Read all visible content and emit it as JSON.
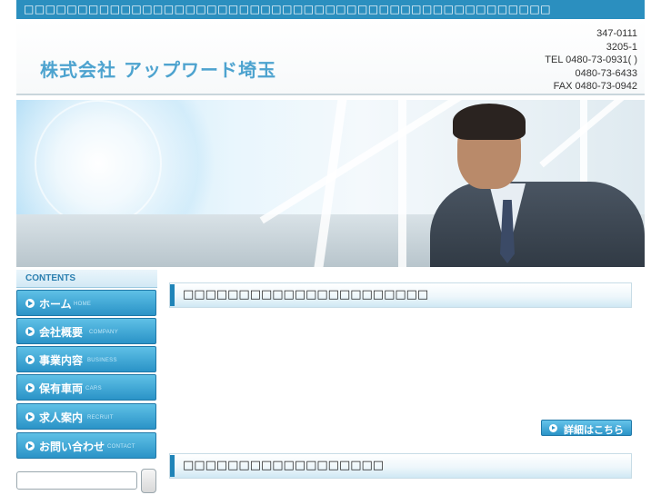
{
  "topbar": {
    "text": "□□□□□□□□□□□□□□□□□□□□□□□□□□□□□□□□□□□□□□□□□□□□□□□□□"
  },
  "header": {
    "logo": "株式会社 アップワード埼玉",
    "contact": {
      "line1": "347-0111",
      "line2": "3205-1",
      "line3": "TEL 0480-73-0931( )",
      "line4": "0480-73-6433",
      "line5": "FAX 0480-73-0942"
    }
  },
  "sidebar": {
    "contents_label": "CONTENTS",
    "items": [
      {
        "label": "ホーム",
        "sub": "HOME"
      },
      {
        "label": "会社概要",
        "sub": "COMPANY"
      },
      {
        "label": "事業内容",
        "sub": "BUSINESS"
      },
      {
        "label": "保有車両",
        "sub": "CARS"
      },
      {
        "label": "求人案内",
        "sub": "RECRUIT"
      },
      {
        "label": "お問い合わせ",
        "sub": "CONTACT"
      }
    ],
    "search": {
      "placeholder": ""
    }
  },
  "main": {
    "section1_title": "□□□□□□□□□□□□□□□□□□□□□□",
    "more_button": "詳細はこちら",
    "section2_title": "□□□□□□□□□□□□□□□□□□"
  },
  "colors": {
    "brand": "#2b8fbf",
    "accent": "#4da3cf",
    "nav": "#2a93c7"
  }
}
